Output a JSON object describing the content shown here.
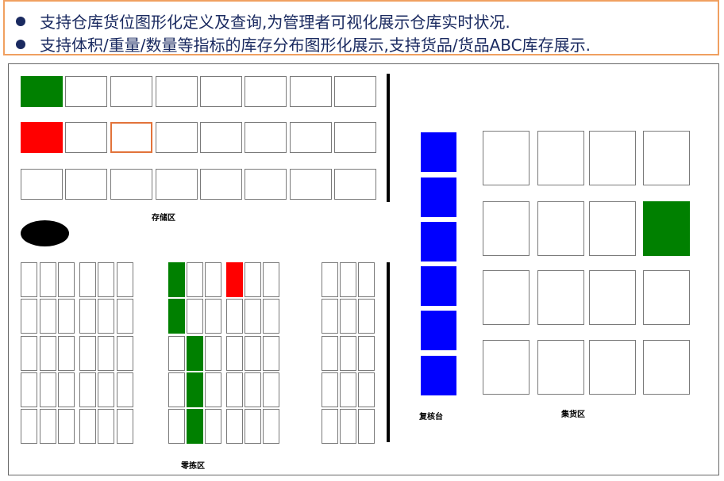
{
  "header": {
    "bullets": [
      "支持仓库货位图形化定义及查询,为管理者可视化展示仓库实时状况.",
      "支持体积/重量/数量等指标的库存分布图形化展示,支持货品/货品ABC库存展示."
    ]
  },
  "zones": {
    "storage": "存储区",
    "picking": "零拣区",
    "review": "复核台",
    "staging": "集货区"
  },
  "storage_status": [
    [
      "green",
      "empty",
      "empty",
      "empty",
      "empty",
      "empty",
      "empty",
      "empty"
    ],
    [
      "red",
      "empty",
      "selected",
      "empty",
      "empty",
      "empty",
      "empty",
      "empty"
    ],
    [
      "empty",
      "empty",
      "empty",
      "empty",
      "empty",
      "empty",
      "empty",
      "empty"
    ]
  ],
  "picking_status": [
    [
      "empty",
      "empty",
      "empty",
      "empty",
      "empty",
      "empty",
      "green",
      "empty",
      "empty",
      "red",
      "empty",
      "empty",
      "empty",
      "empty",
      "empty"
    ],
    [
      "empty",
      "empty",
      "empty",
      "empty",
      "empty",
      "empty",
      "green",
      "empty",
      "empty",
      "empty",
      "empty",
      "empty",
      "empty",
      "empty",
      "empty"
    ],
    [
      "empty",
      "empty",
      "empty",
      "empty",
      "empty",
      "empty",
      "empty",
      "green",
      "empty",
      "empty",
      "empty",
      "empty",
      "empty",
      "empty",
      "empty"
    ],
    [
      "empty",
      "empty",
      "empty",
      "empty",
      "empty",
      "empty",
      "empty",
      "green",
      "empty",
      "empty",
      "empty",
      "empty",
      "empty",
      "empty",
      "empty"
    ],
    [
      "empty",
      "empty",
      "empty",
      "empty",
      "empty",
      "empty",
      "empty",
      "green",
      "empty",
      "empty",
      "empty",
      "empty",
      "empty",
      "empty",
      "empty"
    ]
  ],
  "review_status": [
    "blue",
    "blue",
    "blue",
    "blue",
    "blue",
    "blue"
  ],
  "staging_status": [
    [
      "empty",
      "empty",
      "empty",
      "empty"
    ],
    [
      "empty",
      "empty",
      "empty",
      "green"
    ],
    [
      "empty",
      "empty",
      "empty",
      "empty"
    ],
    [
      "empty",
      "empty",
      "empty",
      "empty"
    ]
  ]
}
